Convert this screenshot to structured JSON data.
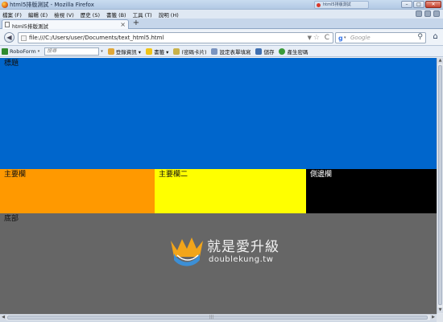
{
  "window": {
    "title": "html5排版測試 - Mozilla Firefox",
    "ghost_tab_title": "html5排版測試",
    "minimize": "–",
    "maximize": "□",
    "close": "✕"
  },
  "menu": {
    "items": [
      "檔案 (F)",
      "編輯 (E)",
      "檢視 (V)",
      "歷史 (S)",
      "書籤 (B)",
      "工具 (T)",
      "說明 (H)"
    ]
  },
  "tabs": {
    "items": [
      {
        "label": "html5排版測試",
        "close": "×"
      }
    ],
    "new_tab": "+"
  },
  "nav": {
    "back": "◀",
    "url": "file:///C:/Users/user/Documents/text_html5.html",
    "url_dropdown": "▼",
    "bookmark_star": "☆",
    "reload": "C",
    "search_engine": "g",
    "search_engine_caret": "▾",
    "search_placeholder": "Google",
    "search_button": "⚲",
    "home": "⌂"
  },
  "toolbar": {
    "roboform_label": "RoboForm",
    "roboform_caret": "▾",
    "search_placeholder": "搜尋",
    "search_caret": "▾",
    "items": [
      {
        "label": "登錄資訊 ▾"
      },
      {
        "label": "書籤 ▾"
      },
      {
        "label": "(密碼卡片)"
      },
      {
        "label": "設定表單填寫"
      },
      {
        "label": "儲存"
      },
      {
        "label": "產生密碼"
      }
    ]
  },
  "page": {
    "header": "標題",
    "main1": "主要欄",
    "main2": "主要欄二",
    "aside": "側邊欄",
    "footer": "底部",
    "watermark_cn": "就是愛升級",
    "watermark_url": "doublekung.tw"
  },
  "colors": {
    "header": "#0066cc",
    "main1": "#ff9900",
    "main2": "#ffff00",
    "aside": "#000000",
    "footer": "#666666"
  },
  "scroll": {
    "up": "▲",
    "down": "▼",
    "left": "◀",
    "right": "▶",
    "grip": "|||"
  }
}
